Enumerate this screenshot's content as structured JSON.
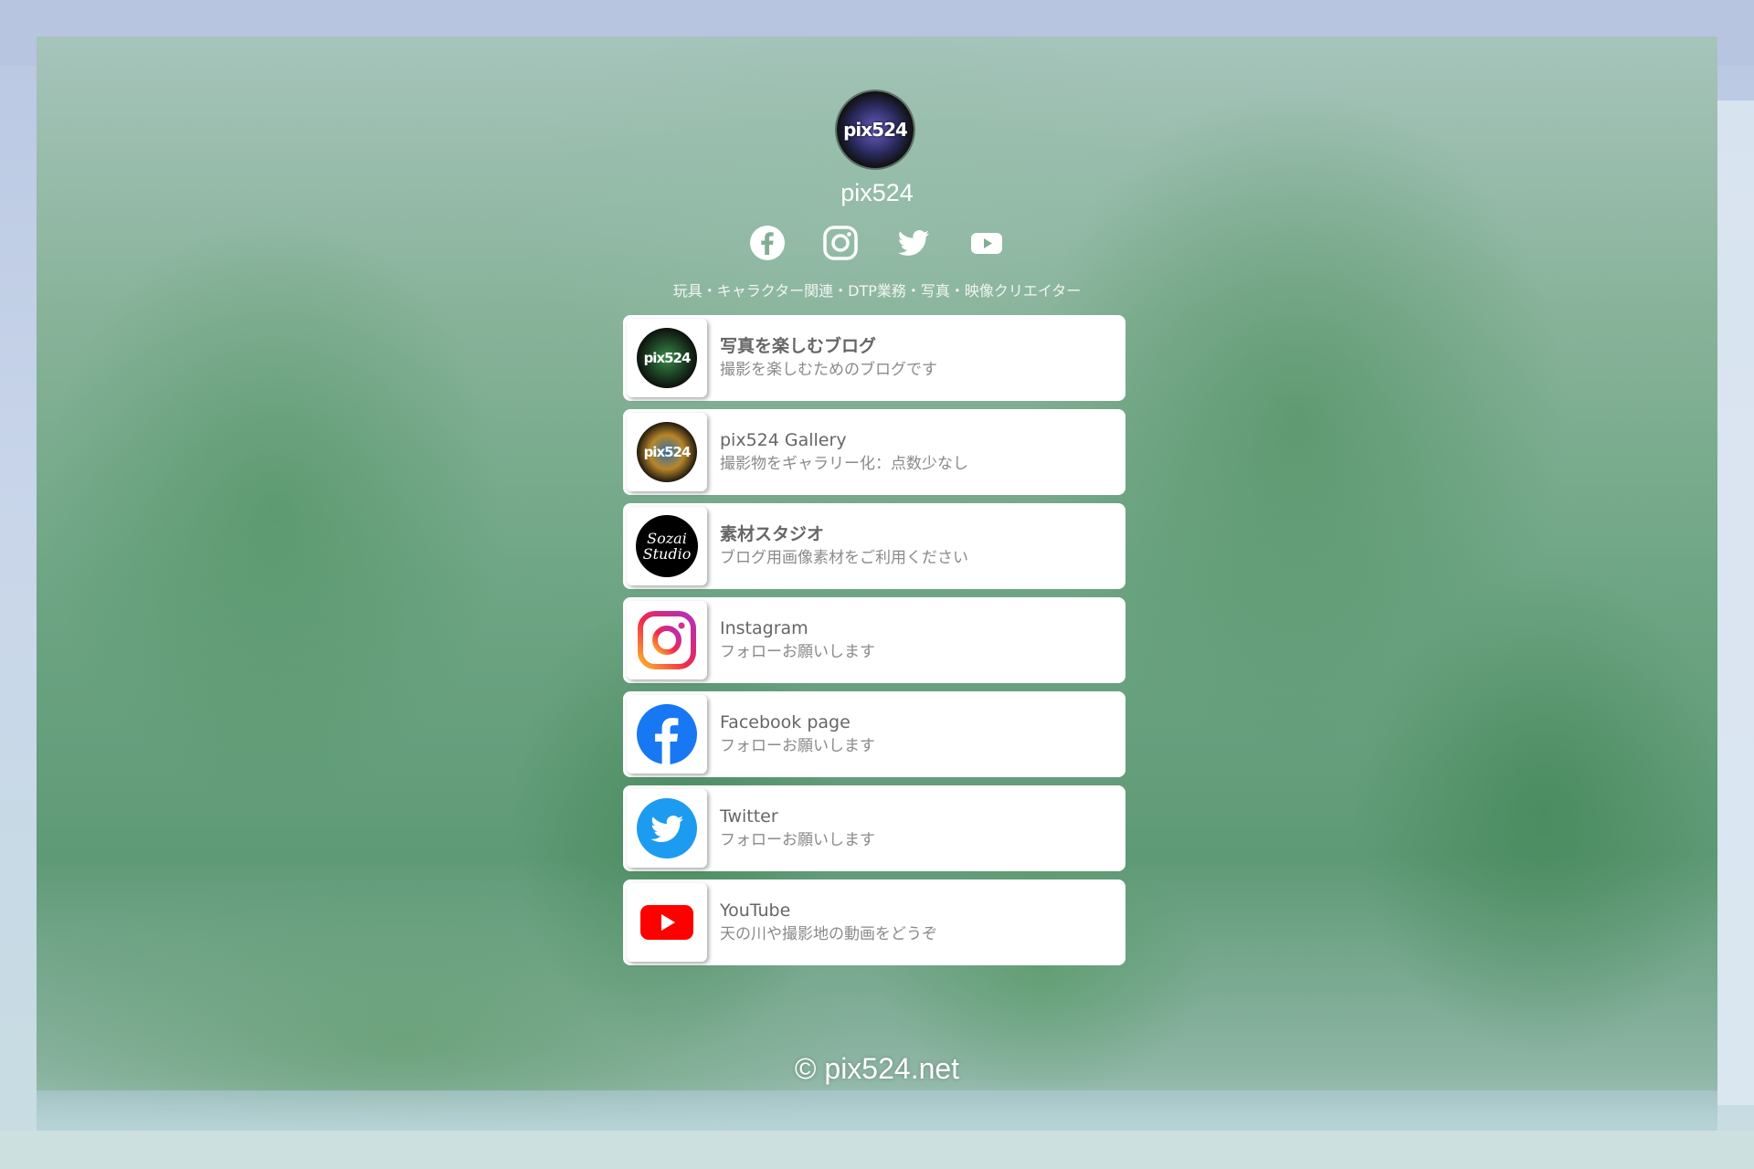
{
  "profile": {
    "avatar_text": "pix524",
    "name": "pix524",
    "tagline": "玩具・キャラクター関連・DTP業務・写真・映像クリエイター"
  },
  "social_icons": [
    {
      "icon": "facebook-icon"
    },
    {
      "icon": "instagram-icon"
    },
    {
      "icon": "twitter-icon"
    },
    {
      "icon": "youtube-icon"
    }
  ],
  "links": [
    {
      "title": "写真を楽しむブログ",
      "desc": "撮影を楽しむためのブログです",
      "icon": "pix524-logo-icon",
      "logo_text": "pix524"
    },
    {
      "title": "pix524 Gallery",
      "desc": "撮影物をギャラリー化：点数少なし",
      "icon": "pix524-gallery-logo-icon",
      "logo_text": "pix524"
    },
    {
      "title": "素材スタジオ",
      "desc": "ブログ用画像素材をご利用ください",
      "icon": "sozai-studio-logo-icon",
      "logo_line1": "Sozai",
      "logo_line2": "Studio"
    },
    {
      "title": "Instagram",
      "desc": "フォローお願いします",
      "icon": "instagram-icon"
    },
    {
      "title": "Facebook page",
      "desc": "フォローお願いします",
      "icon": "facebook-icon"
    },
    {
      "title": "Twitter",
      "desc": "フォローお願いします",
      "icon": "twitter-icon"
    },
    {
      "title": "YouTube",
      "desc": "天の川や撮影地の動画をどうぞ",
      "icon": "youtube-icon"
    }
  ],
  "footer": {
    "copyright": "© pix524.net"
  },
  "colors": {
    "facebook": "#1877f2",
    "twitter": "#1d9bf0",
    "youtube": "#ff0000",
    "card_bg": "#ffffff",
    "title_text": "#666666",
    "desc_text": "#8a8a8a"
  }
}
